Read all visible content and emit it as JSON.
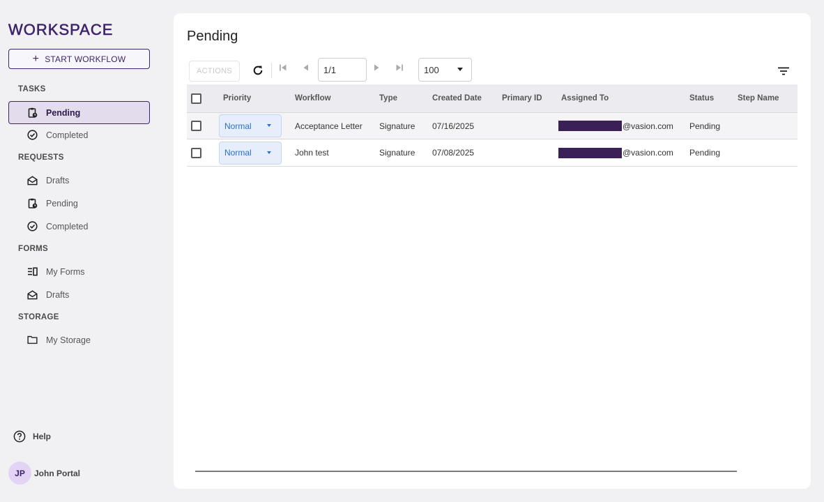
{
  "app": {
    "logo": "WORKSPACE",
    "start_workflow": "START WORKFLOW"
  },
  "sidebar": {
    "sections": [
      {
        "label": "TASKS",
        "items": [
          {
            "label": "Pending",
            "icon": "clipboard-clock-icon"
          },
          {
            "label": "Completed",
            "icon": "check-circle-icon"
          }
        ]
      },
      {
        "label": "REQUESTS",
        "items": [
          {
            "label": "Drafts",
            "icon": "open-envelope-icon"
          },
          {
            "label": "Pending",
            "icon": "clipboard-clock-icon"
          },
          {
            "label": "Completed",
            "icon": "check-circle-icon"
          }
        ]
      },
      {
        "label": "FORMS",
        "items": [
          {
            "label": "My Forms",
            "icon": "form-list-icon"
          },
          {
            "label": "Drafts",
            "icon": "open-envelope-icon"
          }
        ]
      },
      {
        "label": "STORAGE",
        "items": [
          {
            "label": "My Storage",
            "icon": "folder-icon"
          }
        ]
      }
    ],
    "active_item": "TASKS/Pending",
    "help": "Help",
    "user": {
      "initials": "JP",
      "name": "John Portal"
    }
  },
  "main": {
    "title": "Pending",
    "toolbar": {
      "actions": "ACTIONS",
      "page": "1/1",
      "per_page": "100"
    },
    "columns": [
      "Priority",
      "Workflow",
      "Type",
      "Created Date",
      "Primary ID",
      "Assigned To",
      "Status",
      "Step Name"
    ],
    "rows": [
      {
        "priority": "Normal",
        "workflow": "Acceptance Letter",
        "type": "Signature",
        "created": "07/16/2025",
        "primary_id": "",
        "assigned_suffix": "@vasion.com",
        "status": "Pending",
        "step": ""
      },
      {
        "priority": "Normal",
        "workflow": "John test",
        "type": "Signature",
        "created": "07/08/2025",
        "primary_id": "",
        "assigned_suffix": "@vasion.com",
        "status": "Pending",
        "step": ""
      }
    ]
  },
  "colors": {
    "brand": "#3e2469",
    "active_bg": "#e3dcec",
    "priority_text": "#2a6fd0",
    "redaction": "#3a2057"
  }
}
